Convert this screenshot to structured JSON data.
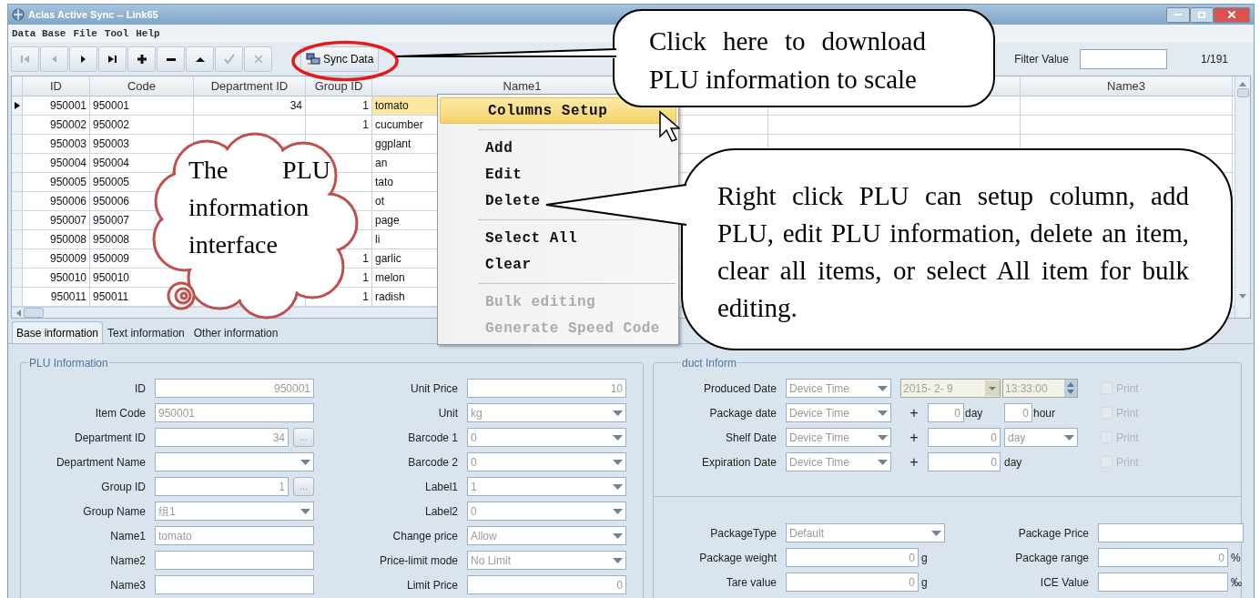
{
  "window": {
    "title": "Aclas Active Sync -- Link65"
  },
  "menu": [
    "Data Base",
    "File",
    "Tool",
    "Help"
  ],
  "toolbar": [
    {
      "kind": "first",
      "disabled": true
    },
    {
      "kind": "previous",
      "disabled": true
    },
    {
      "kind": "next",
      "disabled": false
    },
    {
      "kind": "last",
      "disabled": false
    },
    {
      "kind": "add",
      "disabled": false
    },
    {
      "kind": "remove",
      "disabled": false
    },
    {
      "kind": "up",
      "disabled": false
    },
    {
      "kind": "confirm",
      "disabled": true
    },
    {
      "kind": "cancel",
      "disabled": true
    }
  ],
  "sync_button": {
    "label": "Sync Data"
  },
  "filter": {
    "label": "Filter Value"
  },
  "record_count": "1/191",
  "table": {
    "columns": [
      "ID",
      "Code",
      "Department ID",
      "Group ID",
      "Name1",
      "Name3"
    ],
    "rows": [
      {
        "id": "950001",
        "code": "950001",
        "department_id": "34",
        "group_id": "1",
        "name1": "tomato",
        "selected": true
      },
      {
        "id": "950002",
        "code": "950002",
        "group_id": "1",
        "name1": "cucumber",
        "selected": false
      },
      {
        "id": "950003",
        "code": "950003",
        "name1": "ggplant",
        "selected": false
      },
      {
        "id": "950004",
        "code": "950004",
        "name1": "an",
        "selected": false
      },
      {
        "id": "950005",
        "code": "950005",
        "name1": "tato",
        "selected": false
      },
      {
        "id": "950006",
        "code": "950006",
        "name1": "ot",
        "selected": false
      },
      {
        "id": "950007",
        "code": "950007",
        "name1": "page",
        "selected": false
      },
      {
        "id": "950008",
        "code": "950008",
        "name1": "li",
        "selected": false
      },
      {
        "id": "950009",
        "code": "950009",
        "group_id": "1",
        "name1": "garlic",
        "selected": false
      },
      {
        "id": "950010",
        "code": "950010",
        "group_id": "1",
        "name1": "melon",
        "selected": false
      },
      {
        "id": "950011",
        "code": "950011",
        "group_id": "1",
        "name1": "radish",
        "selected": false
      }
    ]
  },
  "tabs": [
    {
      "label": "Base information",
      "selected": true
    },
    {
      "label": "Text information",
      "selected": false
    },
    {
      "label": "Other information",
      "selected": false
    }
  ],
  "plu_information": {
    "title": "PLU Information",
    "rows": [
      [
        {
          "label": "ID",
          "kind": "number",
          "value": "950001"
        },
        {
          "label": "Unit Price",
          "kind": "number",
          "value": "10"
        }
      ],
      [
        {
          "label": "Item Code",
          "kind": "text",
          "value": "950001"
        },
        {
          "label": "Unit",
          "kind": "dropdown",
          "value": "kg"
        }
      ],
      [
        {
          "label": "Department ID",
          "kind": "lookup",
          "value": "34",
          "button": "..."
        },
        {
          "label": "Barcode 1",
          "kind": "dropdown",
          "value": "0"
        }
      ],
      [
        {
          "label": "Department Name",
          "kind": "dropdown"
        },
        {
          "label": "Barcode 2",
          "kind": "dropdown",
          "value": "0"
        }
      ],
      [
        {
          "label": "Group ID",
          "kind": "lookup",
          "value": "1",
          "button": "..."
        },
        {
          "label": "Label1",
          "kind": "dropdown",
          "value": "1"
        }
      ],
      [
        {
          "label": "Group Name",
          "kind": "dropdown",
          "value": "组1"
        },
        {
          "label": "Label2",
          "kind": "dropdown",
          "value": "0"
        }
      ],
      [
        {
          "label": "Name1",
          "kind": "text",
          "value": "tomato"
        },
        {
          "label": "Change price",
          "kind": "dropdown",
          "value": "Allow"
        }
      ],
      [
        {
          "label": "Name2",
          "kind": "text"
        },
        {
          "label": "Price-limit mode",
          "kind": "dropdown",
          "value": "No Limit"
        }
      ],
      [
        {
          "label": "Name3",
          "kind": "text"
        },
        {
          "label": "Limit Price",
          "kind": "number",
          "value": "0"
        }
      ]
    ]
  },
  "product_information": {
    "title": "duct Inform",
    "date_rows": [
      {
        "label": "Produced Date",
        "source": "Device Time",
        "kind": "datetime",
        "date": "2015- 2- 9",
        "time": "13:33:00",
        "print_label": "Print",
        "print_checked": false
      },
      {
        "label": "Package date",
        "source": "Device Time",
        "kind": "offset_hours",
        "plus": "+",
        "days": "0",
        "day_unit": "day",
        "hours": "0",
        "hour_unit": "hour",
        "print_label": "Print",
        "print_checked": false
      },
      {
        "label": "Shelf Date",
        "source": "Device Time",
        "kind": "offset_select",
        "plus": "+",
        "days": "0",
        "day_unit": "day",
        "print_label": "Print",
        "print_checked": false
      },
      {
        "label": "Expiration Date",
        "source": "Device Time",
        "kind": "offset_days",
        "plus": "+",
        "days": "0",
        "day_unit": "day",
        "print_label": "Print",
        "print_checked": false
      }
    ],
    "package_fields": [
      {
        "label": "PackageType",
        "kind": "dropdown",
        "value": "Default"
      },
      {
        "label": "Package Price",
        "kind": "number"
      },
      {
        "label": "Package weight",
        "kind": "number",
        "value": "0",
        "unit": "g"
      },
      {
        "label": "Package range",
        "kind": "number",
        "value": "0",
        "unit": "%"
      },
      {
        "label": "Tare value",
        "kind": "number",
        "value": "0",
        "unit": "g"
      },
      {
        "label": "ICE Value",
        "kind": "number",
        "unit": "‰"
      }
    ]
  },
  "context_menu": [
    {
      "kind": "item",
      "label": "Columns Setup",
      "selected": true,
      "disabled": false
    },
    {
      "kind": "separator"
    },
    {
      "kind": "item",
      "label": "Add",
      "selected": false,
      "disabled": false
    },
    {
      "kind": "item",
      "label": "Edit",
      "selected": false,
      "disabled": false
    },
    {
      "kind": "item",
      "label": "Delete",
      "selected": false,
      "disabled": false
    },
    {
      "kind": "separator"
    },
    {
      "kind": "item",
      "label": "Select All",
      "selected": false,
      "disabled": false
    },
    {
      "kind": "item",
      "label": "Clear",
      "selected": false,
      "disabled": false
    },
    {
      "kind": "separator"
    },
    {
      "kind": "item",
      "label": "Bulk editing",
      "selected": false,
      "disabled": true
    },
    {
      "kind": "item",
      "label": "Generate Speed Code",
      "selected": false,
      "disabled": true
    }
  ],
  "callouts": [
    {
      "text": "Click here to download PLU information to scale"
    },
    {
      "text": "Right click PLU can setup column, add PLU, edit PLU information, delete an item, clear all items, or select All item for bulk editing."
    }
  ],
  "cloud_note": {
    "text": "The PLU information interface"
  }
}
